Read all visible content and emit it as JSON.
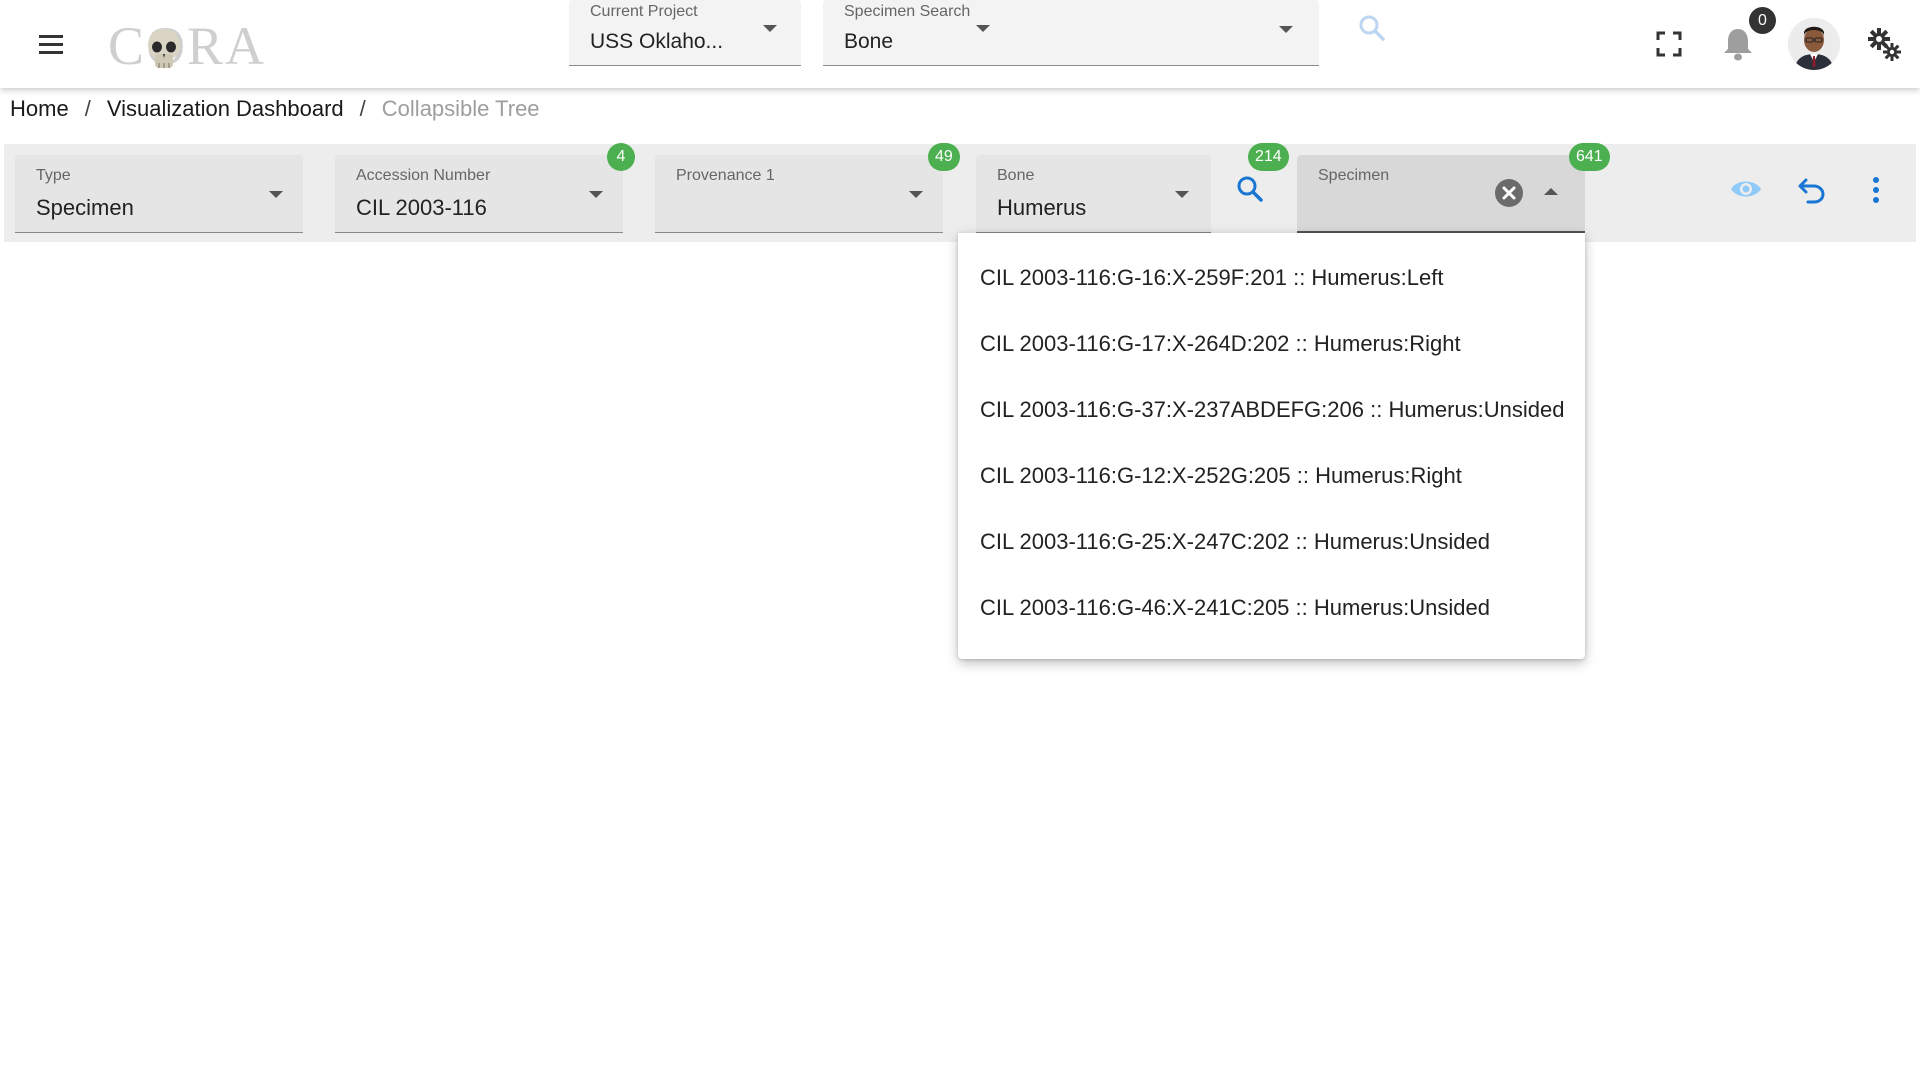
{
  "app": {
    "logo_text": "CORA",
    "notification_count": "0"
  },
  "header": {
    "project": {
      "label": "Current Project",
      "value": "USS Oklaho..."
    },
    "specimen_search": {
      "label": "Specimen Search",
      "value": "Bone"
    }
  },
  "breadcrumb": {
    "items": [
      "Home",
      "Visualization Dashboard",
      "Collapsible Tree"
    ],
    "separator": "/"
  },
  "filters": {
    "type": {
      "label": "Type",
      "value": "Specimen"
    },
    "accession": {
      "label": "Accession Number",
      "value": "CIL 2003-116",
      "count": "4"
    },
    "provenance": {
      "label": "Provenance 1",
      "value": "",
      "count": "49"
    },
    "bone": {
      "label": "Bone",
      "value": "Humerus",
      "count": "214"
    },
    "specimen": {
      "label": "Specimen",
      "value": "",
      "count": "641"
    }
  },
  "dropdown": {
    "options": [
      "CIL 2003-116:G-16:X-259F:201 :: Humerus:Left",
      "CIL 2003-116:G-17:X-264D:202 :: Humerus:Right",
      "CIL 2003-116:G-37:X-237ABDEFG:206 :: Humerus:Unsided",
      "CIL 2003-116:G-12:X-252G:205 :: Humerus:Right",
      "CIL 2003-116:G-25:X-247C:202 :: Humerus:Unsided",
      "CIL 2003-116:G-46:X-241C:205 :: Humerus:Unsided"
    ]
  },
  "colors": {
    "badge_green": "#4caf50",
    "accent_blue": "#1976d2",
    "disabled_blue": "#90caf9"
  },
  "icons": [
    "menu-icon",
    "skull-icon",
    "search-icon",
    "fullscreen-icon",
    "bell-icon",
    "gears-icon",
    "clear-icon",
    "eye-icon",
    "undo-icon",
    "more-vert-icon"
  ]
}
